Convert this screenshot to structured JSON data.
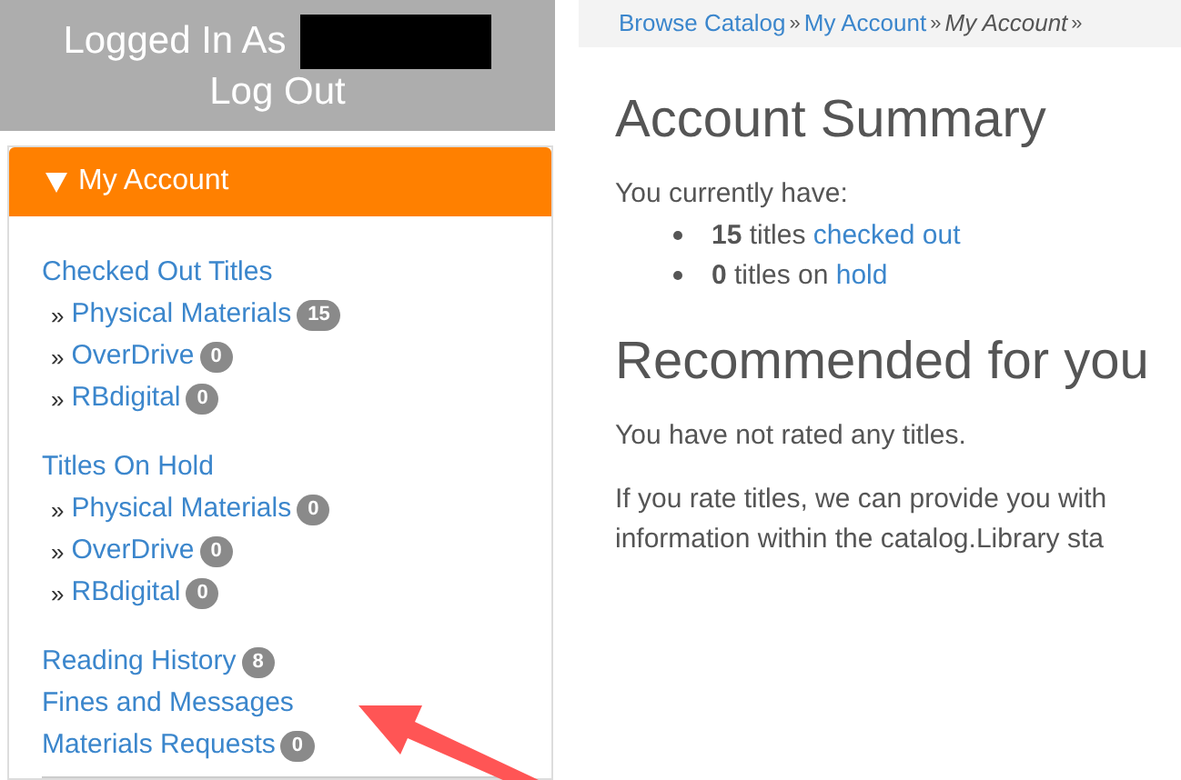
{
  "sidebar": {
    "login_label": "Logged In As",
    "logout": "Log Out",
    "panel": {
      "title": "My Account",
      "expanded": true,
      "items": [
        {
          "label": "Checked Out Titles",
          "children": [
            {
              "marker": "»",
              "label": "Physical Materials",
              "badge": "15"
            },
            {
              "marker": "»",
              "label": "OverDrive",
              "badge": "0"
            },
            {
              "marker": "»",
              "label": "RBdigital",
              "badge": "0"
            }
          ]
        },
        {
          "label": "Titles On Hold",
          "children": [
            {
              "marker": "»",
              "label": "Physical Materials",
              "badge": "0"
            },
            {
              "marker": "»",
              "label": "OverDrive",
              "badge": "0"
            },
            {
              "marker": "»",
              "label": "RBdigital",
              "badge": "0"
            }
          ]
        },
        {
          "label": "Reading History",
          "badge": "8"
        },
        {
          "label": "Fines and Messages"
        },
        {
          "label": "Materials Requests",
          "badge": "0"
        }
      ]
    }
  },
  "breadcrumbs": [
    {
      "label": "Browse Catalog",
      "separator": "»",
      "current": false
    },
    {
      "label": "My Account",
      "separator": "»",
      "current": false
    },
    {
      "label": "My Account",
      "separator": "»",
      "current": true
    }
  ],
  "summary": {
    "title": "Account Summary",
    "intro": "You currently have:",
    "items": [
      {
        "count": "15",
        "text": "titles",
        "link": "checked out"
      },
      {
        "count": "0",
        "text": "titles on",
        "link": "hold"
      }
    ]
  },
  "recommended": {
    "title": "Recommended for you",
    "note": "You have not rated any titles.",
    "lines": [
      "If you rate titles, we can provide you with",
      "information within the catalog.Library sta"
    ]
  }
}
